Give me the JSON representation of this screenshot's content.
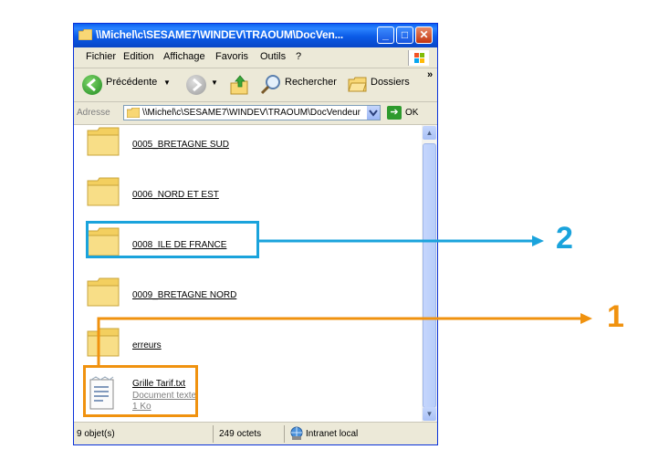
{
  "window": {
    "title": "\\\\Michel\\c\\SESAME7\\WINDEV\\TRAOUM\\DocVen...",
    "min_label": "_",
    "max_label": "□",
    "close_label": "✕"
  },
  "menu": {
    "items": [
      {
        "label": "Fichier"
      },
      {
        "label": "Edition"
      },
      {
        "label": "Affichage"
      },
      {
        "label": "Favoris"
      },
      {
        "label": "Outils"
      },
      {
        "label": "?"
      }
    ]
  },
  "toolbar": {
    "back_label": "Précédente",
    "search_label": "Rechercher",
    "folders_label": "Dossiers",
    "more_label": "»"
  },
  "address": {
    "label": "Adresse",
    "value": "\\\\Michel\\c\\SESAME7\\WINDEV\\TRAOUM\\DocVendeur",
    "go_label": "OK"
  },
  "files": [
    {
      "name": "0005_BRETAGNE SUD",
      "type": "folder"
    },
    {
      "name": "0006_NORD ET EST",
      "type": "folder"
    },
    {
      "name": "0008_ILE DE FRANCE",
      "type": "folder"
    },
    {
      "name": "0009_BRETAGNE NORD",
      "type": "folder"
    },
    {
      "name": "erreurs",
      "type": "folder"
    },
    {
      "name": "Grille Tarif.txt",
      "type": "text",
      "kind": "Document texte",
      "size": "1 Ko"
    }
  ],
  "status": {
    "count": "9 objet(s)",
    "size": "249 octets",
    "zone": "Intranet local"
  },
  "callouts": {
    "blue_number": "2",
    "orange_number": "1",
    "blue_color": "#1aa3dc",
    "orange_color": "#f0920f"
  }
}
